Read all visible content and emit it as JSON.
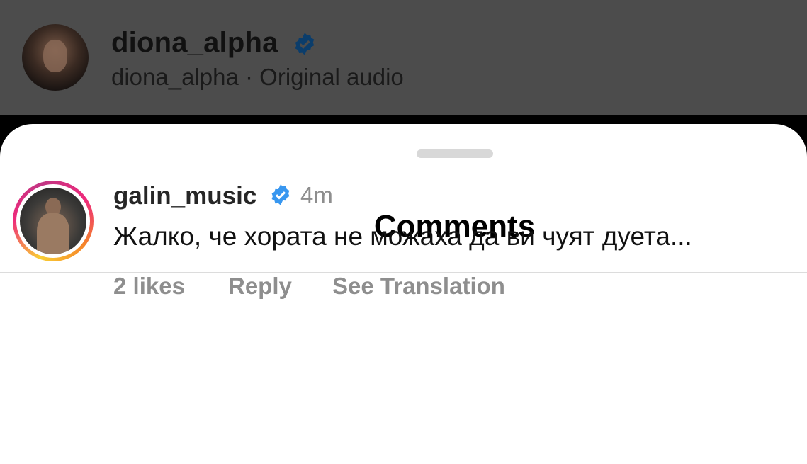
{
  "header": {
    "username": "diona_alpha",
    "subtitle": "diona_alpha · Original audio"
  },
  "sheet": {
    "title": "Comments"
  },
  "comments": [
    {
      "username": "galin_music",
      "verified": true,
      "time": "4m",
      "text": "Жалко, че хората не можаха да ви чуят дуета...",
      "likes": "2 likes",
      "reply_label": "Reply",
      "translate_label": "See Translation"
    }
  ],
  "colors": {
    "verified": "#3897f0",
    "overlay": "#4c4c4c",
    "muted": "#8e8e8e"
  },
  "icons": [
    "verified-badge-icon"
  ]
}
